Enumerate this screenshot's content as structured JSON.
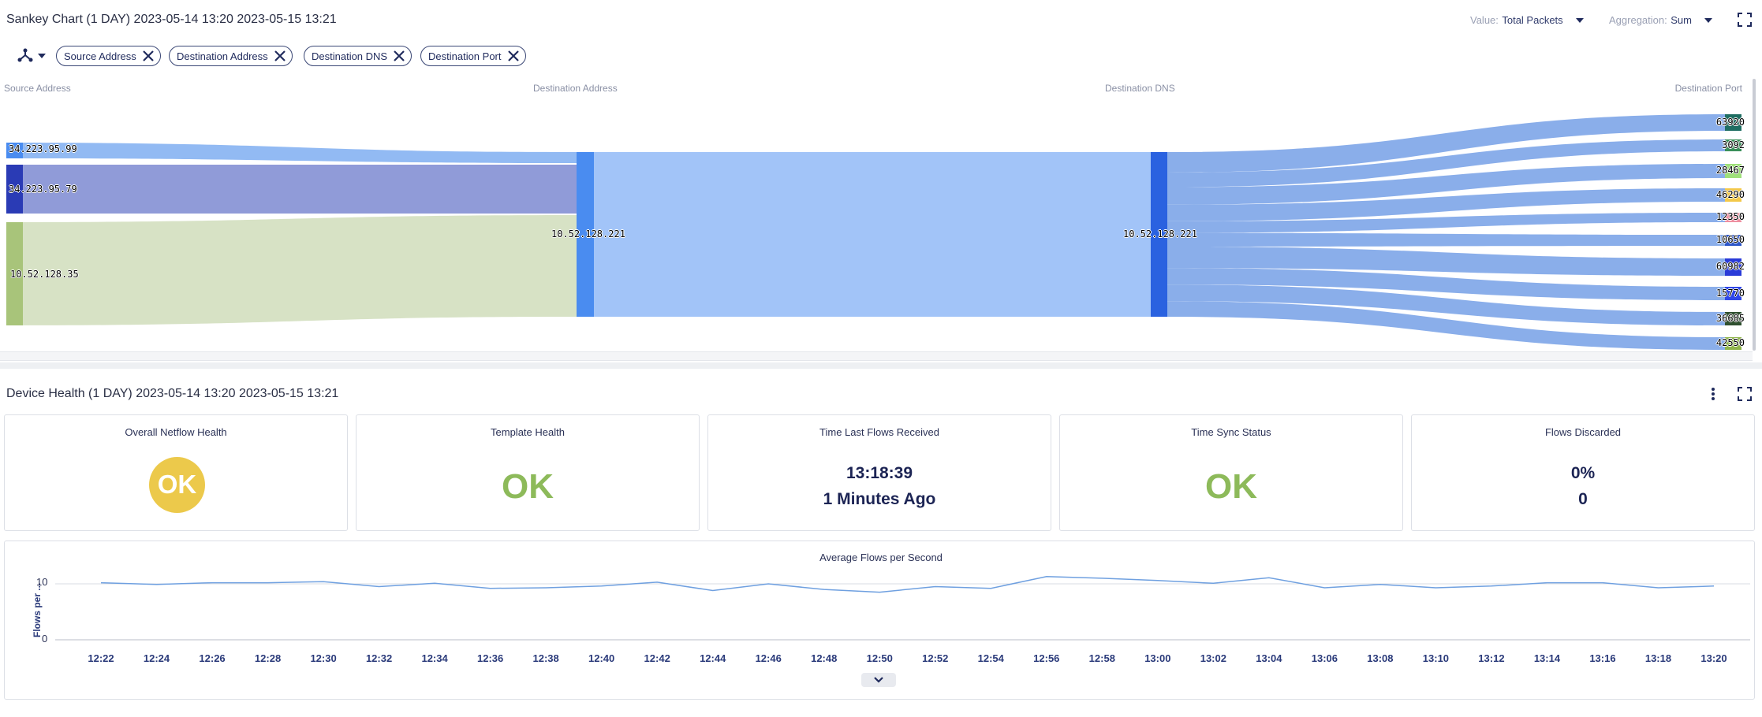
{
  "sankey": {
    "title": "Sankey Chart (1 DAY) 2023-05-14 13:20 2023-05-15 13:21",
    "value_label": "Value:",
    "value_selected": "Total Packets",
    "aggregation_label": "Aggregation:",
    "aggregation_selected": "Sum",
    "filters": [
      "Source Address",
      "Destination Address",
      "Destination DNS",
      "Destination Port"
    ],
    "columns": [
      "Source Address",
      "Destination Address",
      "Destination DNS",
      "Destination Port"
    ],
    "source_nodes": [
      "34.223.95.99",
      "34.223.95.79",
      "10.52.128.35"
    ],
    "dest_address_node": "10.52.128.221",
    "dest_dns_node": "10.52.128.221",
    "ports": [
      "63920",
      "3092",
      "28467",
      "46290",
      "12350",
      "10650",
      "60982",
      "15770",
      "36685",
      "42550"
    ],
    "port_colors": [
      "#1f6e62",
      "#3a8f5a",
      "#9fe07a",
      "#f3c84a",
      "#ee8fa0",
      "#2d56c9",
      "#2a3bd8",
      "#3047e8",
      "#2f4f2f",
      "#8fb44a"
    ],
    "source_colors": [
      "#4a8cf0",
      "#2a3bb5",
      "#a8c47a"
    ]
  },
  "health": {
    "title": "Device Health (1 DAY) 2023-05-14 13:20 2023-05-15 13:21",
    "cards": {
      "overall": {
        "title": "Overall Netflow Health",
        "value": "OK"
      },
      "template": {
        "title": "Template Health",
        "value": "OK"
      },
      "last_flows": {
        "title": "Time Last Flows Received",
        "time": "13:18:39",
        "ago": "1 Minutes Ago"
      },
      "time_sync": {
        "title": "Time Sync Status",
        "value": "OK"
      },
      "discarded": {
        "title": "Flows Discarded",
        "percent": "0%",
        "count": "0"
      }
    },
    "colors": {
      "ok_badge": "#ecc94b",
      "ok_green": "#8dba5a",
      "line": "#6fa0e0"
    }
  },
  "chart_data": {
    "type": "line",
    "title": "Average Flows per Second",
    "ylabel": "Flows per ...",
    "xlabel": "",
    "ylim": [
      0,
      12
    ],
    "yticks": [
      0,
      10
    ],
    "x_tick_labels": [
      "12:22",
      "12:24",
      "12:26",
      "12:28",
      "12:30",
      "12:32",
      "12:34",
      "12:36",
      "12:38",
      "12:40",
      "12:42",
      "12:44",
      "12:46",
      "12:48",
      "12:50",
      "12:52",
      "12:54",
      "12:56",
      "12:58",
      "13:00",
      "13:02",
      "13:04",
      "13:06",
      "13:08",
      "13:10",
      "13:12",
      "13:14",
      "13:16",
      "13:18",
      "13:20"
    ],
    "series": [
      {
        "values": [
          10.2,
          9.9,
          10.2,
          10.2,
          10.4,
          9.5,
          10.1,
          9.2,
          9.3,
          9.6,
          10.3,
          8.8,
          10.0,
          9.0,
          8.5,
          9.5,
          9.2,
          11.3,
          11.0,
          10.6,
          10.1,
          11.1,
          9.3,
          9.9,
          9.3,
          9.6,
          10.2,
          10.2,
          9.3,
          9.6
        ]
      }
    ]
  }
}
